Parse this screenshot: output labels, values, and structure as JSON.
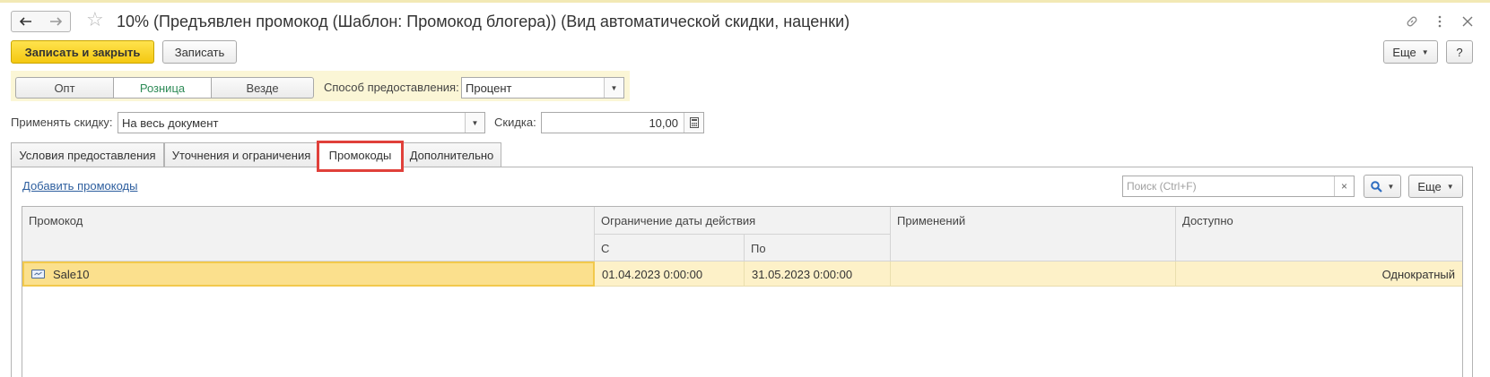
{
  "window": {
    "title": "10% (Предъявлен промокод (Шаблон: Промокод блогера)) (Вид автоматической скидки, наценки)"
  },
  "toolbar": {
    "save_close_label": "Записать и закрыть",
    "save_label": "Записать",
    "more_label": "Еще",
    "help_label": "?"
  },
  "channel_selector": {
    "options": [
      "Опт",
      "Розница",
      "Везде"
    ],
    "selected": "Розница"
  },
  "provision_method": {
    "label": "Способ предоставления:",
    "value": "Процент"
  },
  "apply_discount": {
    "label": "Применять скидку:",
    "value": "На весь документ"
  },
  "discount": {
    "label": "Скидка:",
    "value": "10,00"
  },
  "tabs": [
    {
      "label": "Условия предоставления"
    },
    {
      "label": "Уточнения и ограничения"
    },
    {
      "label": "Промокоды"
    },
    {
      "label": "Дополнительно"
    }
  ],
  "active_tab": "Промокоды",
  "promocodes": {
    "add_link": "Добавить промокоды",
    "search_placeholder": "Поиск (Ctrl+F)",
    "more_label": "Еще",
    "columns": {
      "promocode": "Промокод",
      "date_limit": "Ограничение даты действия",
      "from": "С",
      "to": "По",
      "applications": "Применений",
      "available": "Доступно"
    },
    "rows": [
      {
        "promocode": "Sale10",
        "from": "01.04.2023 0:00:00",
        "to": "31.05.2023 0:00:00",
        "applications": "",
        "available": "Однократный"
      }
    ]
  },
  "colors": {
    "primary_button": "#f4c811",
    "active_segment_text": "#2e8b57",
    "tab_highlight": "#e0403a",
    "selected_row": "#fdf1c8",
    "link": "#2d5e9e"
  }
}
